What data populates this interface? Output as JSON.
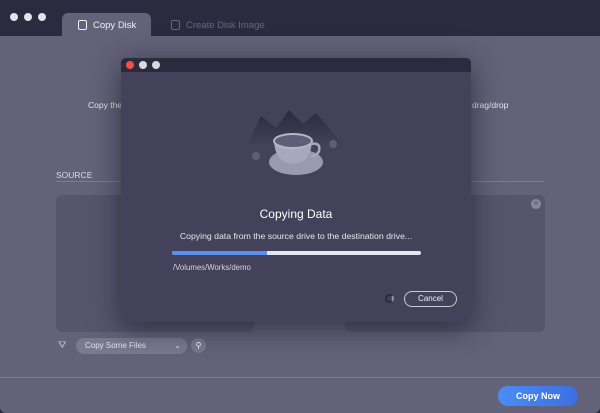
{
  "window": {
    "tabs": [
      {
        "label": "Copy Disk",
        "active": true,
        "icon": "copy-disk-icon"
      },
      {
        "label": "Create Disk Image",
        "active": false,
        "icon": "disk-image-icon"
      }
    ]
  },
  "main": {
    "description_left": "Copy the",
    "description_right": "drag/drop",
    "source_label": "SOURCE",
    "filter_select": "Copy Some Files",
    "copy_now": "Copy Now"
  },
  "modal": {
    "title": "Copying Data",
    "message": "Copying data from the source drive to the destination drive...",
    "progress_percent": 38,
    "path": "/Volumes/Works/demo",
    "cancel": "Cancel",
    "accent": "#5b8ef0"
  }
}
